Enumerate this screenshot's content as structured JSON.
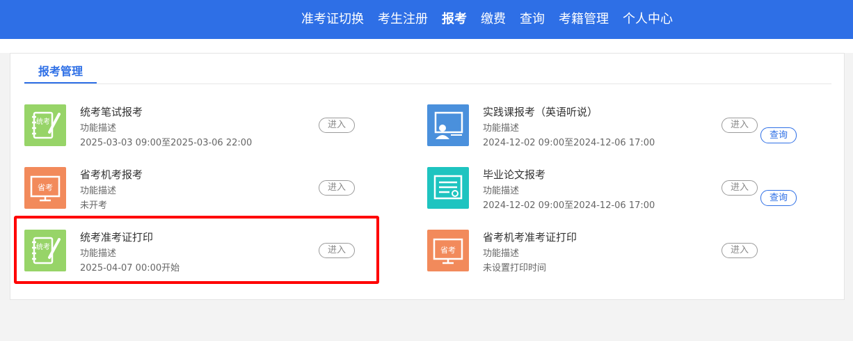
{
  "nav": {
    "items": [
      "准考证切换",
      "考生注册",
      "报考",
      "缴费",
      "查询",
      "考籍管理",
      "个人中心"
    ],
    "active": "报考"
  },
  "panel": {
    "tab_label": "报考管理"
  },
  "common": {
    "enter_label": "进入",
    "query_label": "查询"
  },
  "cards": [
    {
      "title": "统考笔试报考",
      "desc": "功能描述",
      "time": "2025-03-03 09:00至2025-03-06 22:00",
      "icon": "notebook-pen-icon",
      "color": "#97d468"
    },
    {
      "title": "实践课报考（英语听说）",
      "desc": "功能描述",
      "time": "2024-12-02 09:00至2024-12-06 17:00",
      "icon": "classroom-board-icon",
      "color": "#4a90dc"
    },
    {
      "title": "省考机考报考",
      "desc": "功能描述",
      "time": "未开考",
      "icon": "monitor-exam-icon",
      "color": "#f28a5b"
    },
    {
      "title": "毕业论文报考",
      "desc": "功能描述",
      "time": "2024-12-02 09:00至2024-12-06 17:00",
      "icon": "certificate-icon",
      "color": "#1ec4c0"
    },
    {
      "title": "统考准考证打印",
      "desc": "功能描述",
      "time": "2025-04-07 00:00开始",
      "icon": "notebook-pen-icon",
      "color": "#97d468"
    },
    {
      "title": "省考机考准考证打印",
      "desc": "功能描述",
      "time": "未设置打印时间",
      "icon": "monitor-exam-icon",
      "color": "#f28a5b"
    }
  ],
  "icon_text": {
    "notebook": "统考",
    "monitor": "省考"
  },
  "highlight_color": "#ff0000"
}
